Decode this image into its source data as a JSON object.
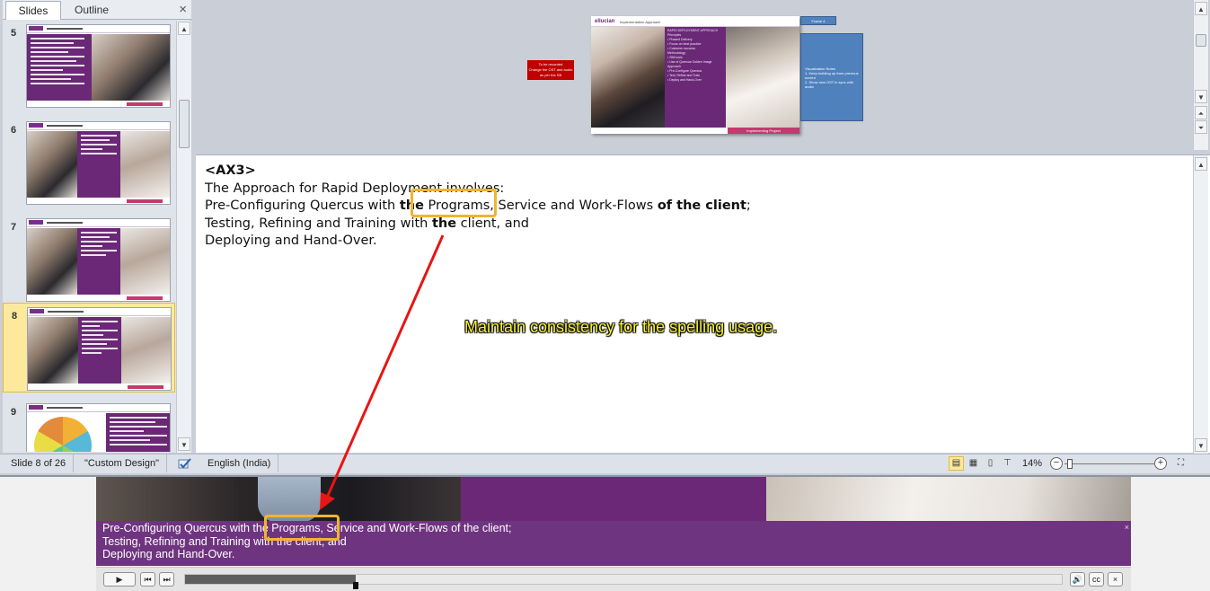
{
  "left_pane": {
    "tabs": [
      {
        "label": "Slides",
        "active": true
      },
      {
        "label": "Outline",
        "active": false
      }
    ],
    "close_glyph": "×",
    "thumbnails": [
      {
        "number": "5",
        "selected": false,
        "layout": "text-photo"
      },
      {
        "number": "6",
        "selected": false,
        "layout": "photo-purple-photo"
      },
      {
        "number": "7",
        "selected": false,
        "layout": "photo-purple-photo"
      },
      {
        "number": "8",
        "selected": true,
        "layout": "photo-purple-photo"
      },
      {
        "number": "9",
        "selected": false,
        "layout": "wheel"
      }
    ]
  },
  "notes": {
    "heading": "<AX3>",
    "line1": "The Approach for Rapid Deployment involves:",
    "line2_a": "Pre-Configuring Quercus with ",
    "line2_bold1": "the",
    "line2_b": " Programs, Service and Work-Flows ",
    "line2_bold2": "of the client",
    "line2_c": ";",
    "line3_a": "Testing, Refining and Training with ",
    "line3_bold": "the",
    "line3_b": " client, and",
    "line4": "Deploying and Hand-Over.",
    "review_comment": "Maintain consistency for the spelling usage."
  },
  "slide_preview": {
    "logo": "ellucian",
    "nav": "Implementation    Approach",
    "footer": "Implementing Project"
  },
  "status_bar": {
    "slide_indicator": "Slide 8 of 26",
    "theme": "\"Custom Design\"",
    "language": "English (India)",
    "zoom": "14%"
  },
  "captions": {
    "line1": "Pre-Configuring Quercus with the Programs, Service and Work-Flows of the client;",
    "line2": "Testing, Refining and Training with the client, and",
    "line3": "Deploying and Hand-Over.",
    "close_glyph": "×"
  },
  "player": {
    "progress": 0.195,
    "cc_label": "cc"
  },
  "colors": {
    "annotation_arrow": "#e81515",
    "highlight_box": "#f0b430",
    "comment_text": "#f7f12c",
    "caption_bg": "#6f3480"
  }
}
